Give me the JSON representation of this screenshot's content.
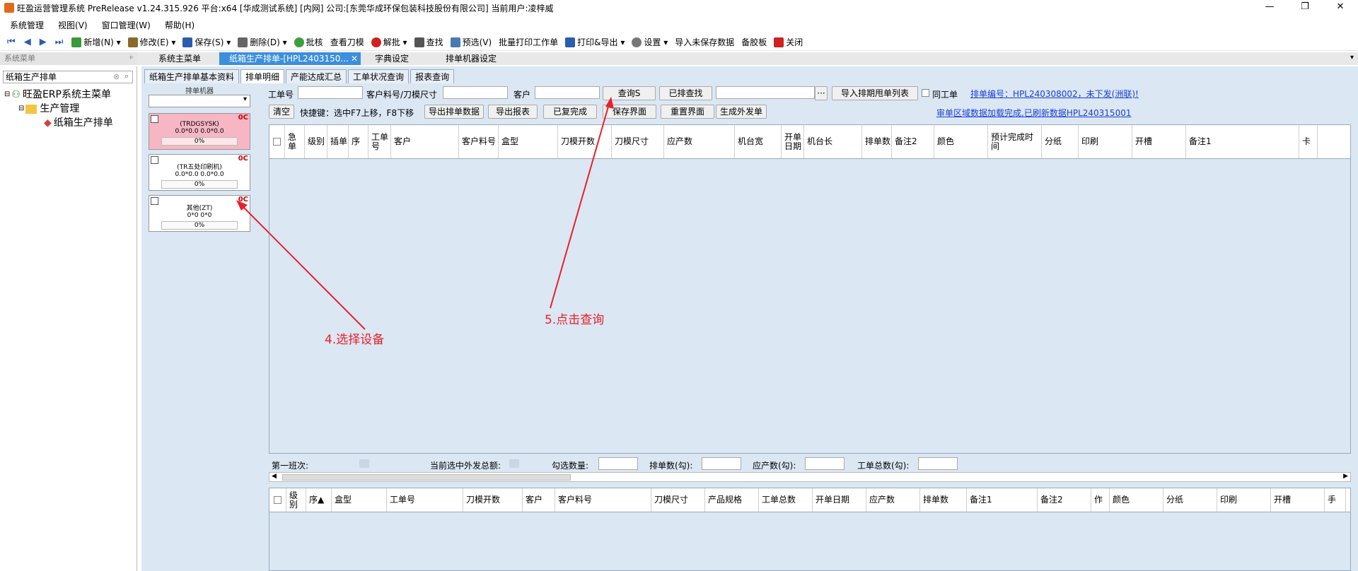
{
  "window": {
    "title": "旺盈运营管理系统 PreRelease v1.24.315.926 平台:x64 [华成测试系统] [内网] 公司:[东莞华成环保包装科技股份有限公司] 当前用户:凌梓威",
    "min": "—",
    "max": "❐",
    "close": "✕"
  },
  "menu": [
    "系统管理",
    "视图(V)",
    "窗口管理(W)",
    "帮助(H)"
  ],
  "toolbar": {
    "nav": [
      "⏮",
      "◀",
      "▶",
      "⏭"
    ],
    "items": [
      {
        "label": "新增(N)",
        "color": "#3a9a3a"
      },
      {
        "label": "修改(E)",
        "color": "#8a6a2a"
      },
      {
        "label": "保存(S)",
        "color": "#2a5db0"
      },
      {
        "label": "删除(D)",
        "color": "#666"
      },
      {
        "label": "批核",
        "color": "#3aa03a"
      },
      {
        "label": "查看刀模",
        "color": ""
      },
      {
        "label": "解批",
        "color": "#d02020"
      },
      {
        "label": "查找",
        "color": "#555"
      },
      {
        "label": "预选(V)",
        "color": "#4a7ab0"
      },
      {
        "label": "批量打印工作单",
        "color": ""
      },
      {
        "label": "打印&导出",
        "color": "#2a5db0"
      },
      {
        "label": "设置",
        "color": "#777"
      },
      {
        "label": "导入未保存数据",
        "color": ""
      },
      {
        "label": "备胶板",
        "color": ""
      },
      {
        "label": "关闭",
        "color": "#d02020"
      }
    ]
  },
  "sidebar": {
    "title": "系统菜单",
    "pin": "ᵖ",
    "search": "纸箱生产排单",
    "tree": {
      "root": "旺盈ERP系统主菜单",
      "folder": "生产管理",
      "leaf": "纸箱生产排单"
    }
  },
  "doctabs": {
    "t1": "系统主菜单",
    "t2": "纸箱生产排单-[HPL2403150...",
    "t3": "字典设定",
    "t4": "排单机器设定",
    "close": "✕"
  },
  "subtabs": [
    "纸箱生产排单基本资料",
    "排单明细",
    "产能达成汇总",
    "工单状况查询",
    "报表查询"
  ],
  "machines": {
    "header": "排单机器",
    "cards": [
      {
        "name": "(TRDGSYSK)",
        "vals": "0.0*0.0   0.0*0.0",
        "pct": "0%",
        "count": "0C"
      },
      {
        "name": "(TR五处印刷机)",
        "vals": "0.0*0.0   0.0*0.0",
        "pct": "0%",
        "count": "0C"
      },
      {
        "name": "其他(ZT)",
        "vals": "0*0   0*0",
        "pct": "0%",
        "count": "0C"
      }
    ]
  },
  "filters": {
    "work_order": "工单号",
    "cust_item": "客户料号/刀模尺寸",
    "customer": "客户",
    "query": "查询S",
    "queried": "已排查找",
    "ellipsis": "···",
    "import": "导入排期甩单列表",
    "same_order": "同工单",
    "schedule_link": "排单编号：HPL240308002，未下发(洲联)!",
    "clear": "清空",
    "shortcut": "快捷键：选中F7上移，F8下移",
    "export_data": "导出排单数据",
    "export_report": "导出报表",
    "done": "已复完成",
    "save_view": "保存界面",
    "reset_view": "重置界面",
    "gen_outsource": "生成外发单",
    "status_link": "审单区域数据加载完成,已刷新数据HPL240315001"
  },
  "grid1": {
    "cols": [
      "",
      "急单",
      "级别",
      "插单",
      "序",
      "工单号",
      "客户",
      "客户料号",
      "盒型",
      "刀模开数",
      "刀模尺寸",
      "应产数",
      "机台宽",
      "开单日期",
      "机台长",
      "排单数",
      "备注2",
      "颜色",
      "预计完成时间",
      "分纸",
      "印刷",
      "开槽",
      "备注1",
      "卡"
    ]
  },
  "summary": {
    "shift": "第一班次:",
    "current": "当前选中外发总额:",
    "checked": "勾选数量:",
    "sched": "排单数(勾):",
    "produce": "应产数(勾):",
    "total": "工单总数(勾):"
  },
  "grid2": {
    "cols": [
      "",
      "级别",
      "序▲",
      "盒型",
      "工单号",
      "刀模开数",
      "客户",
      "客户料号",
      "刀模尺寸",
      "产品规格",
      "工单总数",
      "开单日期",
      "应产数",
      "排单数",
      "备注1",
      "备注2",
      "作",
      "颜色",
      "分纸",
      "印刷",
      "开槽",
      "手"
    ]
  },
  "annotations": {
    "step4": "4.选择设备",
    "step5": "5.点击查询"
  }
}
